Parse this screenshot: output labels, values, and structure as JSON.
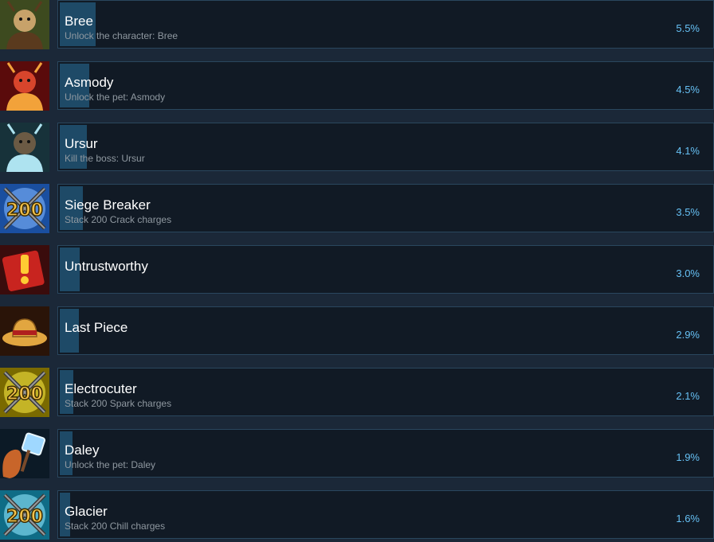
{
  "achievements": [
    {
      "title": "Bree",
      "description": "Unlock the character: Bree",
      "percent_label": "5.5%",
      "percent": 5.5,
      "icon": "deer-warrior-icon",
      "icon_colors": [
        "#3d4a1f",
        "#c7a26a",
        "#5a3a1e"
      ]
    },
    {
      "title": "Asmody",
      "description": "Unlock the pet: Asmody",
      "percent_label": "4.5%",
      "percent": 4.5,
      "icon": "red-demon-pet-icon",
      "icon_colors": [
        "#5a0b0b",
        "#d8452c",
        "#f2a23a"
      ]
    },
    {
      "title": "Ursur",
      "description": "Kill the boss: Ursur",
      "percent_label": "4.1%",
      "percent": 4.1,
      "icon": "antlered-bear-boss-icon",
      "icon_colors": [
        "#17323a",
        "#6b5a44",
        "#aee3f0"
      ]
    },
    {
      "title": "Siege Breaker",
      "description": "Stack 200 Crack charges",
      "percent_label": "3.5%",
      "percent": 3.5,
      "icon": "200-crossed-swords-blue-icon",
      "icon_colors": [
        "#1a4fa0",
        "#7fb6ff",
        "#f2c14a"
      ]
    },
    {
      "title": "Untrustworthy",
      "description": "",
      "percent_label": "3.0%",
      "percent": 3.0,
      "icon": "red-book-exclamation-icon",
      "icon_colors": [
        "#3a0c0c",
        "#c8241f",
        "#ffcc33"
      ]
    },
    {
      "title": "Last Piece",
      "description": "",
      "percent_label": "2.9%",
      "percent": 2.9,
      "icon": "straw-hat-icon",
      "icon_colors": [
        "#2a1408",
        "#e2a640",
        "#b01e1e"
      ]
    },
    {
      "title": "Electrocuter",
      "description": "Stack 200 Spark charges",
      "percent_label": "2.1%",
      "percent": 2.1,
      "icon": "200-crossed-swords-yellow-icon",
      "icon_colors": [
        "#7a6a00",
        "#f5e640",
        "#f2c14a"
      ]
    },
    {
      "title": "Daley",
      "description": "Unlock the pet: Daley",
      "percent_label": "1.9%",
      "percent": 1.9,
      "icon": "squirrel-ice-hammer-icon",
      "icon_colors": [
        "#0c1a26",
        "#c8652a",
        "#9fd8ff"
      ]
    },
    {
      "title": "Glacier",
      "description": "Stack 200 Chill charges",
      "percent_label": "1.6%",
      "percent": 1.6,
      "icon": "200-crossed-swords-cyan-icon",
      "icon_colors": [
        "#0f6c86",
        "#8fe8ff",
        "#f2c14a"
      ]
    }
  ]
}
